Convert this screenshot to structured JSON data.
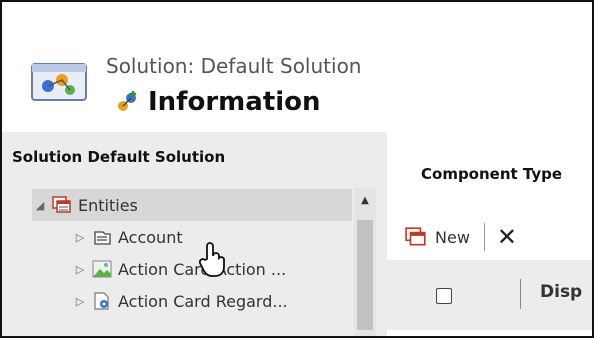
{
  "header": {
    "caption": "Solution: Default Solution",
    "title": "Information"
  },
  "nav": {
    "header": "Solution Default Solution",
    "items": [
      {
        "label": "Entities",
        "icon": "entities-icon",
        "expanded": true
      },
      {
        "label": "Account",
        "icon": "entity-icon"
      },
      {
        "label": "Action Card Action ...",
        "icon": "broken-image-icon"
      },
      {
        "label": "Action Card Regard...",
        "icon": "gear-document-icon"
      }
    ]
  },
  "right": {
    "component_type_label": "Component Type",
    "toolbar": {
      "new_label": "New",
      "delete_icon": "close-icon"
    },
    "grid": {
      "display_column": "Disp"
    }
  },
  "colors": {
    "accent": "#1e73be",
    "nav_bg": "#ececec",
    "selected_bg": "#d7d7d7"
  }
}
